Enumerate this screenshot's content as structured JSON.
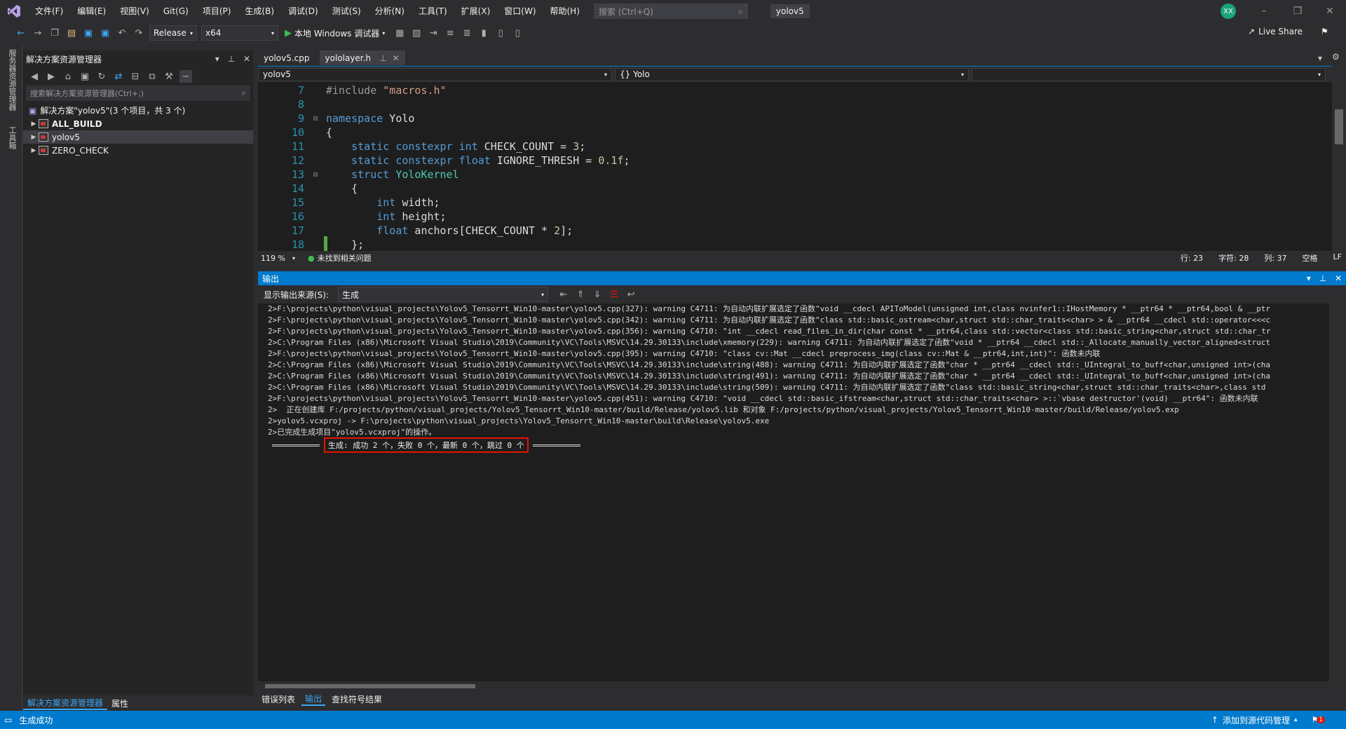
{
  "title_bar": {
    "menus": [
      "文件(F)",
      "编辑(E)",
      "视图(V)",
      "Git(G)",
      "项目(P)",
      "生成(B)",
      "调试(D)",
      "测试(S)",
      "分析(N)",
      "工具(T)",
      "扩展(X)",
      "窗口(W)",
      "帮助(H)"
    ],
    "search_placeholder": "搜索 (Ctrl+Q)",
    "solution_name": "yolov5",
    "avatar_initials": "XX"
  },
  "toolbar": {
    "configuration": "Release",
    "platform": "x64",
    "run_label": "本地 Windows 调试器",
    "live_share": "Live Share"
  },
  "side_strip": {
    "tab1": "服务器资源管理器",
    "tab2": "工具箱"
  },
  "solution_explorer": {
    "title": "解决方案资源管理器",
    "search_placeholder": "搜索解决方案资源管理器(Ctrl+;)",
    "root": "解决方案\"yolov5\"(3 个项目，共 3 个)",
    "items": [
      {
        "label": "ALL_BUILD",
        "bold": true
      },
      {
        "label": "yolov5",
        "bold": false
      },
      {
        "label": "ZERO_CHECK",
        "bold": false
      }
    ],
    "bottom_tabs": [
      "解决方案资源管理器",
      "属性"
    ]
  },
  "editor": {
    "tabs": [
      {
        "label": "yolov5.cpp",
        "active": false
      },
      {
        "label": "yololayer.h",
        "active": true
      }
    ],
    "nav_project": "yolov5",
    "nav_scope": "{} Yolo",
    "lines": [
      {
        "n": "7",
        "text": "#include \"macros.h\""
      },
      {
        "n": "8",
        "text": ""
      },
      {
        "n": "9",
        "text": "namespace Yolo"
      },
      {
        "n": "10",
        "text": "{"
      },
      {
        "n": "11",
        "text": "    static constexpr int CHECK_COUNT = 3;"
      },
      {
        "n": "12",
        "text": "    static constexpr float IGNORE_THRESH = 0.1f;"
      },
      {
        "n": "13",
        "text": "    struct YoloKernel"
      },
      {
        "n": "14",
        "text": "    {"
      },
      {
        "n": "15",
        "text": "        int width;"
      },
      {
        "n": "16",
        "text": "        int height;"
      },
      {
        "n": "17",
        "text": "        float anchors[CHECK_COUNT * 2];"
      },
      {
        "n": "18",
        "text": "    };"
      }
    ],
    "zoom": "119 %",
    "issues": "未找到相关问题",
    "line_info": "行: 23",
    "char_info": "字符: 28",
    "col_info": "列: 37",
    "whitespace": "空格",
    "eol": "LF"
  },
  "output": {
    "title": "输出",
    "source_label": "显示输出来源(S):",
    "source_value": "生成",
    "lines": [
      "2>F:\\projects\\python\\visual_projects\\Yolov5_Tensorrt_Win10-master\\yolov5.cpp(327): warning C4711: 为自动内联扩展选定了函数\"void __cdecl APIToModel(unsigned int,class nvinfer1::IHostMemory * __ptr64 * __ptr64,bool & __ptr",
      "2>F:\\projects\\python\\visual_projects\\Yolov5_Tensorrt_Win10-master\\yolov5.cpp(342): warning C4711: 为自动内联扩展选定了函数\"class std::basic_ostream<char,struct std::char_traits<char> > & __ptr64 __cdecl std::operator<<<c",
      "2>F:\\projects\\python\\visual_projects\\Yolov5_Tensorrt_Win10-master\\yolov5.cpp(356): warning C4710: \"int __cdecl read_files_in_dir(char const * __ptr64,class std::vector<class std::basic_string<char,struct std::char_tr",
      "2>C:\\Program Files (x86)\\Microsoft Visual Studio\\2019\\Community\\VC\\Tools\\MSVC\\14.29.30133\\include\\xmemory(229): warning C4711: 为自动内联扩展选定了函数\"void * __ptr64 __cdecl std::_Allocate_manually_vector_aligned<struct",
      "2>F:\\projects\\python\\visual_projects\\Yolov5_Tensorrt_Win10-master\\yolov5.cpp(395): warning C4710: \"class cv::Mat __cdecl preprocess_img(class cv::Mat & __ptr64,int,int)\": 函数未内联",
      "2>C:\\Program Files (x86)\\Microsoft Visual Studio\\2019\\Community\\VC\\Tools\\MSVC\\14.29.30133\\include\\string(488): warning C4711: 为自动内联扩展选定了函数\"char * __ptr64 __cdecl std::_UIntegral_to_buff<char,unsigned int>(cha",
      "2>C:\\Program Files (x86)\\Microsoft Visual Studio\\2019\\Community\\VC\\Tools\\MSVC\\14.29.30133\\include\\string(491): warning C4711: 为自动内联扩展选定了函数\"char * __ptr64 __cdecl std::_UIntegral_to_buff<char,unsigned int>(cha",
      "2>C:\\Program Files (x86)\\Microsoft Visual Studio\\2019\\Community\\VC\\Tools\\MSVC\\14.29.30133\\include\\string(509): warning C4711: 为自动内联扩展选定了函数\"class std::basic_string<char,struct std::char_traits<char>,class std",
      "2>F:\\projects\\python\\visual_projects\\Yolov5_Tensorrt_Win10-master\\yolov5.cpp(451): warning C4710: \"void __cdecl std::basic_ifstream<char,struct std::char_traits<char> >::`vbase destructor'(void) __ptr64\": 函数未内联",
      "2>  正在创建库 F:/projects/python/visual_projects/Yolov5_Tensorrt_Win10-master/build/Release/yolov5.lib 和对象 F:/projects/python/visual_projects/Yolov5_Tensorrt_Win10-master/build/Release/yolov5.exp",
      "2>yolov5.vcxproj -> F:\\projects\\python\\visual_projects\\Yolov5_Tensorrt_Win10-master\\build\\Release\\yolov5.exe",
      "2>已完成生成项目\"yolov5.vcxproj\"的操作。"
    ],
    "summary": "生成: 成功 2 个，失败 0 个，最新 0 个，跳过 0 个",
    "bottom_tabs": [
      {
        "label": "错误列表",
        "active": false
      },
      {
        "label": "输出",
        "active": true
      },
      {
        "label": "查找符号结果",
        "active": false
      }
    ]
  },
  "status_bar": {
    "message": "生成成功",
    "source_control": "添加到源代码管理",
    "notification_count": "1"
  },
  "colors": {
    "accent": "#007acc",
    "highlight_box": "#e51400"
  }
}
